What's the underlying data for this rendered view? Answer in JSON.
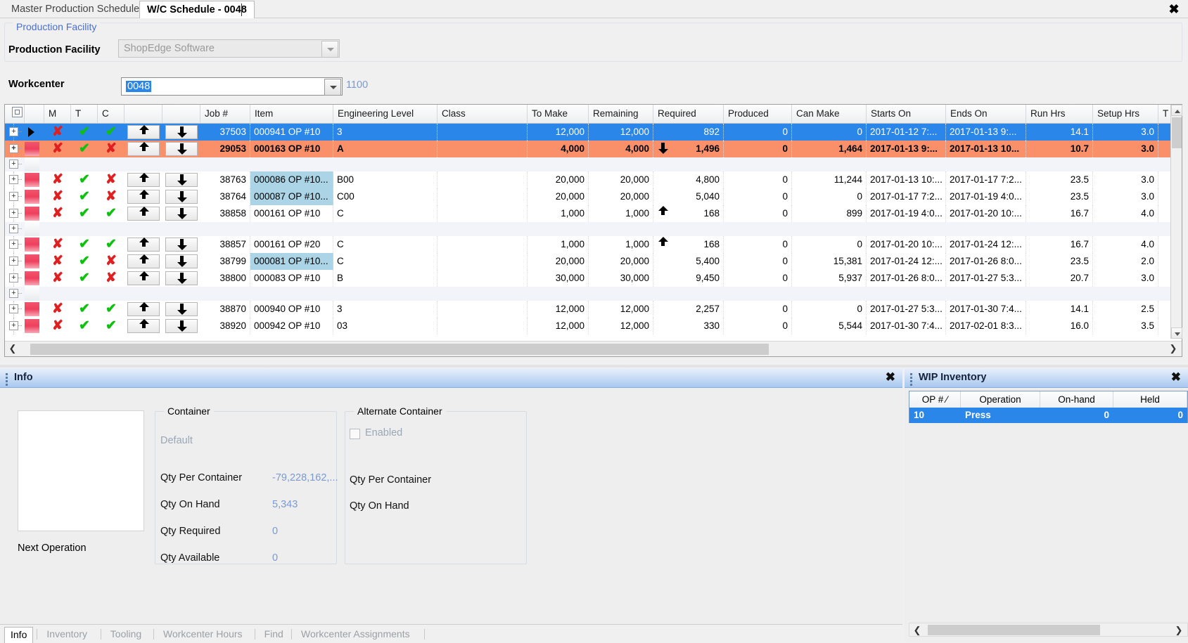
{
  "window": {
    "close_label": "✖"
  },
  "tabs": [
    {
      "label": "Master Production Schedule",
      "active": false
    },
    {
      "label": "W/C Schedule - 0048",
      "active": true
    }
  ],
  "production_facility": {
    "legend": "Production Facility",
    "label": "Production Facility",
    "value": "ShopEdge Software"
  },
  "workcenter": {
    "label": "Workcenter",
    "value": "0048",
    "number": "1100"
  },
  "grid": {
    "columns": [
      "M",
      "T",
      "C",
      "",
      "",
      "Job #",
      "Item",
      "Engineering Level",
      "Class",
      "To Make",
      "Remaining",
      "Required",
      "Produced",
      "Can Make",
      "Starts On",
      "Ends On",
      "Run Hrs",
      "Setup Hrs",
      "T"
    ],
    "rows": [
      {
        "kind": "data",
        "state": "selected",
        "marker": "play",
        "m": "x",
        "t": "check",
        "c": "check",
        "job": "37503",
        "item": "000941 OP #10",
        "item_hl": false,
        "eng": "3",
        "class": "",
        "to_make": "12,000",
        "remaining": "12,000",
        "rem_arrow": "",
        "required": "892",
        "produced": "0",
        "can_make": "0",
        "starts_on": "2017-01-12 7:...",
        "ends_on": "2017-01-13 9:...",
        "run_hrs": "14.1",
        "setup_hrs": "3.0"
      },
      {
        "kind": "data",
        "state": "orange",
        "marker": "swatch",
        "m": "x",
        "t": "check",
        "c": "x",
        "job": "29053",
        "item": "000163 OP #10",
        "item_hl": false,
        "eng": "A",
        "class": "",
        "to_make": "4,000",
        "remaining": "4,000",
        "rem_arrow": "down",
        "required": "1,496",
        "produced": "0",
        "can_make": "1,464",
        "starts_on": "2017-01-13 9:...",
        "ends_on": "2017-01-13 10...",
        "run_hrs": "10.7",
        "setup_hrs": "3.0"
      },
      {
        "kind": "group"
      },
      {
        "kind": "data",
        "state": "normal",
        "marker": "swatch",
        "m": "x",
        "t": "check",
        "c": "x",
        "job": "38763",
        "item": "000086 OP #10...",
        "item_hl": true,
        "eng": "B00",
        "class": "",
        "to_make": "20,000",
        "remaining": "20,000",
        "rem_arrow": "",
        "required": "4,800",
        "produced": "0",
        "can_make": "11,244",
        "starts_on": "2017-01-13 10:...",
        "ends_on": "2017-01-17 7:2...",
        "run_hrs": "23.5",
        "setup_hrs": "3.0"
      },
      {
        "kind": "data",
        "state": "normal",
        "marker": "swatch",
        "m": "x",
        "t": "check",
        "c": "x",
        "job": "38764",
        "item": "000087 OP #10...",
        "item_hl": true,
        "eng": "C00",
        "class": "",
        "to_make": "20,000",
        "remaining": "20,000",
        "rem_arrow": "",
        "required": "5,040",
        "produced": "0",
        "can_make": "0",
        "starts_on": "2017-01-17 7:2...",
        "ends_on": "2017-01-19 4:0...",
        "run_hrs": "23.5",
        "setup_hrs": "3.0"
      },
      {
        "kind": "data",
        "state": "normal",
        "marker": "swatch",
        "m": "x",
        "t": "check",
        "c": "check",
        "job": "38858",
        "item": "000161 OP #10",
        "item_hl": false,
        "eng": "C",
        "class": "",
        "to_make": "1,000",
        "remaining": "1,000",
        "rem_arrow": "up",
        "required": "168",
        "produced": "0",
        "can_make": "899",
        "starts_on": "2017-01-19 4:0...",
        "ends_on": "2017-01-20 10:...",
        "run_hrs": "16.7",
        "setup_hrs": "4.0"
      },
      {
        "kind": "group"
      },
      {
        "kind": "data",
        "state": "normal",
        "marker": "swatch",
        "m": "x",
        "t": "check",
        "c": "check",
        "job": "38857",
        "item": "000161 OP #20",
        "item_hl": false,
        "eng": "C",
        "class": "",
        "to_make": "1,000",
        "remaining": "1,000",
        "rem_arrow": "up",
        "required": "168",
        "produced": "0",
        "can_make": "0",
        "starts_on": "2017-01-20 10:...",
        "ends_on": "2017-01-24 12:...",
        "run_hrs": "16.7",
        "setup_hrs": "4.0"
      },
      {
        "kind": "data",
        "state": "normal",
        "marker": "swatch",
        "m": "x",
        "t": "check",
        "c": "x",
        "job": "38799",
        "item": "000081 OP #10...",
        "item_hl": true,
        "eng": "C",
        "class": "",
        "to_make": "20,000",
        "remaining": "20,000",
        "rem_arrow": "",
        "required": "5,400",
        "produced": "0",
        "can_make": "15,381",
        "starts_on": "2017-01-24 12:...",
        "ends_on": "2017-01-26 8:0...",
        "run_hrs": "23.5",
        "setup_hrs": "2.0"
      },
      {
        "kind": "data",
        "state": "normal",
        "marker": "swatch",
        "m": "x",
        "t": "check",
        "c": "x",
        "job": "38800",
        "item": "000083 OP #10",
        "item_hl": false,
        "eng": "B",
        "class": "",
        "to_make": "30,000",
        "remaining": "30,000",
        "rem_arrow": "",
        "required": "9,450",
        "produced": "0",
        "can_make": "5,937",
        "starts_on": "2017-01-26 8:0...",
        "ends_on": "2017-01-27 5:3...",
        "run_hrs": "20.7",
        "setup_hrs": "3.0"
      },
      {
        "kind": "group"
      },
      {
        "kind": "data",
        "state": "normal",
        "marker": "swatch",
        "m": "x",
        "t": "check",
        "c": "check",
        "job": "38870",
        "item": "000940 OP #10",
        "item_hl": false,
        "eng": "3",
        "class": "",
        "to_make": "12,000",
        "remaining": "12,000",
        "rem_arrow": "",
        "required": "2,257",
        "produced": "0",
        "can_make": "0",
        "starts_on": "2017-01-27 5:3...",
        "ends_on": "2017-01-30 7:4...",
        "run_hrs": "14.1",
        "setup_hrs": "2.5"
      },
      {
        "kind": "data",
        "state": "normal",
        "marker": "swatch",
        "m": "x",
        "t": "check",
        "c": "check",
        "job": "38920",
        "item": "000942 OP #10",
        "item_hl": false,
        "eng": "03",
        "class": "",
        "to_make": "12,000",
        "remaining": "12,000",
        "rem_arrow": "",
        "required": "330",
        "produced": "0",
        "can_make": "5,544",
        "starts_on": "2017-01-30 7:4...",
        "ends_on": "2017-02-01 8:3...",
        "run_hrs": "16.0",
        "setup_hrs": "3.5"
      }
    ]
  },
  "info_panel": {
    "title": "Info",
    "close_label": "✖",
    "next_operation_label": "Next Operation",
    "container": {
      "legend": "Container",
      "default_label": "Default",
      "fields": [
        {
          "label": "Qty Per Container",
          "value": "-79,228,162,..."
        },
        {
          "label": "Qty On Hand",
          "value": "5,343"
        },
        {
          "label": "Qty Required",
          "value": "0"
        },
        {
          "label": "Qty Available",
          "value": "0"
        }
      ]
    },
    "alternate_container": {
      "legend": "Alternate Container",
      "enabled_label": "Enabled",
      "enabled": false,
      "fields": [
        {
          "label": "Qty Per Container",
          "value": ""
        },
        {
          "label": "Qty On Hand",
          "value": ""
        }
      ]
    }
  },
  "wip_panel": {
    "title": "WIP Inventory",
    "close_label": "✖",
    "columns": [
      "OP #",
      "Operation",
      "On-hand",
      "Held"
    ],
    "sort_indicator": "⁄",
    "rows": [
      {
        "op": "10",
        "operation": "Press",
        "on_hand": "0",
        "held": "0"
      }
    ]
  },
  "bottom_tabs": [
    {
      "label": "Info",
      "active": true
    },
    {
      "label": "Inventory",
      "active": false
    },
    {
      "label": "Tooling",
      "active": false
    },
    {
      "label": "Workcenter Hours",
      "active": false
    },
    {
      "label": "Find",
      "active": false
    },
    {
      "label": "Workcenter Assignments",
      "active": false
    }
  ]
}
